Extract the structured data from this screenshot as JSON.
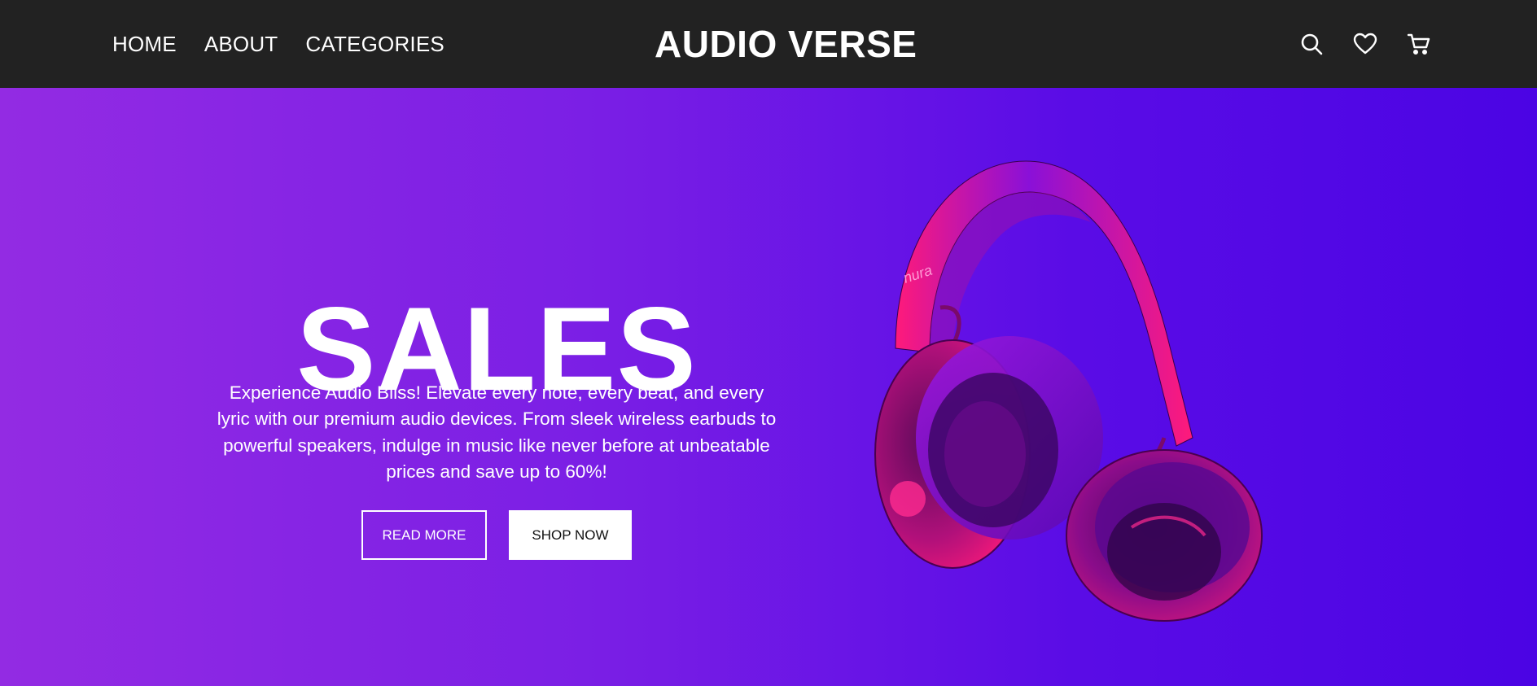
{
  "header": {
    "nav": [
      {
        "label": "HOME"
      },
      {
        "label": "ABOUT"
      },
      {
        "label": "CATEGORIES"
      }
    ],
    "brand": "AUDIO VERSE",
    "icons": [
      "search-icon",
      "heart-icon",
      "cart-icon"
    ]
  },
  "hero": {
    "title": "SALES",
    "description": "Experience Audio Bliss! Elevate every note, every beat, and every lyric with our premium audio devices. From sleek wireless earbuds to powerful speakers, indulge in music like never before at unbeatable prices and save up to 60%!",
    "read_more_label": "READ MORE",
    "shop_now_label": "SHOP NOW",
    "product_brand_mark": "nura"
  },
  "colors": {
    "header_bg": "#222222",
    "hero_gradient_start": "#932be3",
    "hero_gradient_end": "#4b04e4",
    "headphone_pink": "#ff1a8c",
    "headphone_purple": "#7a0fd6"
  }
}
